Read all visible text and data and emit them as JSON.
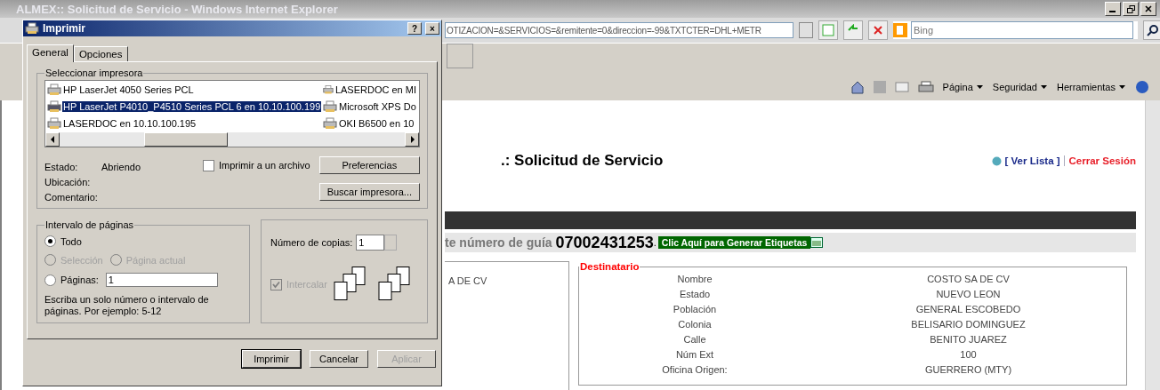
{
  "browser": {
    "title": "ALMEX:: Solicitud de Servicio - Windows Internet Explorer",
    "address": "OTIZACION=&SERVICIOS=&remitente=0&direccion=-99&TXTCTER=DHL+METR",
    "search_placeholder": "Bing",
    "commands": [
      "Página",
      "Seguridad",
      "Herramientas"
    ]
  },
  "page": {
    "heading": ".: Solicitud de Servicio",
    "list_link": "[ Ver Lista ]",
    "logout_link": "Cerrar Sesión",
    "guide_label": "te número de guía",
    "guide_number": "07002431253",
    "guide_suffix": ".",
    "labels_button": "Clic Aquí para Generar Etiquetas",
    "sender_partial": "A DE CV",
    "recipient": {
      "legend": "Destinatario",
      "rows": [
        {
          "label": "Nombre",
          "value": "COSTO SA DE CV"
        },
        {
          "label": "Estado",
          "value": "NUEVO LEON"
        },
        {
          "label": "Población",
          "value": "GENERAL ESCOBEDO"
        },
        {
          "label": "Colonia",
          "value": "BELISARIO DOMINGUEZ"
        },
        {
          "label": "Calle",
          "value": "BENITO JUAREZ"
        },
        {
          "label": "Núm Ext",
          "value": "100"
        },
        {
          "label": "Oficina Origen:",
          "value": "GUERRERO (MTY)"
        }
      ]
    }
  },
  "dialog": {
    "title": "Imprimir",
    "help": "?",
    "close": "×",
    "tabs": [
      {
        "label": "General",
        "selected": true
      },
      {
        "label": "Opciones",
        "selected": false
      }
    ],
    "printers": {
      "legend": "Seleccionar impresora",
      "items": [
        {
          "name": "HP LaserJet 4050 Series PCL",
          "selected": false
        },
        {
          "name": "LASERDOC en MI",
          "selected": false
        },
        {
          "name": "HP LaserJet P4010_P4510 Series PCL 6 en 10.10.100.199",
          "selected": true
        },
        {
          "name": "Microsoft XPS Do",
          "selected": false
        },
        {
          "name": "LASERDOC en 10.10.100.195",
          "selected": false
        },
        {
          "name": "OKI B6500 en 10",
          "selected": false
        }
      ]
    },
    "status": [
      {
        "label": "Estado:",
        "value": "Abriendo"
      },
      {
        "label": "Ubicación:"
      },
      {
        "label": "Comentario:"
      }
    ],
    "print_to_file": {
      "label": "Imprimir a un archivo",
      "checked": false
    },
    "preferences_button": "Preferencias",
    "find_button": "Buscar impresora...",
    "range": {
      "legend": "Intervalo de páginas",
      "options": [
        {
          "label": "Todo",
          "selected": true,
          "disabled": false
        },
        {
          "label": "Selección",
          "selected": false,
          "disabled": true
        },
        {
          "label": "Página actual",
          "selected": false,
          "disabled": true
        },
        {
          "label": "Páginas:",
          "selected": false,
          "disabled": false
        }
      ],
      "pages_value": "1",
      "hint": "Escriba un solo número o intervalo de páginas. Por ejemplo: 5-12"
    },
    "copies": {
      "label": "Número de copias:",
      "value": "1",
      "collate": {
        "label": "Intercalar",
        "checked": true,
        "disabled": true
      }
    },
    "buttons": [
      {
        "label": "Imprimir",
        "disabled": false
      },
      {
        "label": "Cancelar",
        "disabled": false
      },
      {
        "label": "Aplicar",
        "disabled": true
      }
    ]
  }
}
